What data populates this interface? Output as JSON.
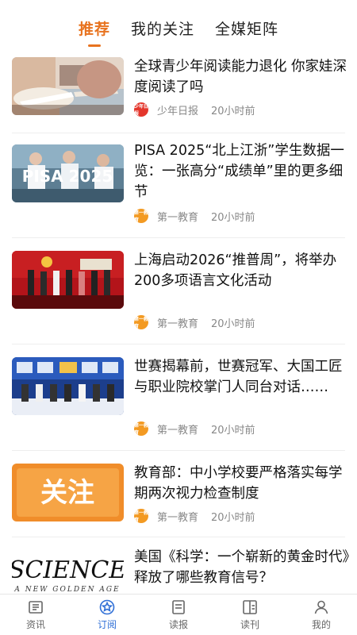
{
  "tabs": [
    {
      "label": "推荐",
      "active": true
    },
    {
      "label": "我的关注",
      "active": false
    },
    {
      "label": "全媒矩阵",
      "active": false
    }
  ],
  "articles": [
    {
      "title": "全球青少年阅读能力退化 你家娃深度阅读了吗",
      "source": "少年日报",
      "source_logo_text": "少年日报",
      "time": "20小时前"
    },
    {
      "title": "PISA 2025“北上江浙”学生数据一览：一张高分“成绩单”里的更多细节",
      "source": "第一教育",
      "source_logo_text": "第一教育",
      "time": "20小时前",
      "thumb_text": "PISA 2025"
    },
    {
      "title": "上海启动2026“推普周”，将举办200多项语言文化活动",
      "source": "第一教育",
      "source_logo_text": "第一教育",
      "time": "20小时前"
    },
    {
      "title": "世赛揭幕前，世赛冠军、大国工匠与职业院校掌门人同台对话……",
      "source": "第一教育",
      "source_logo_text": "第一教育",
      "time": "20小时前"
    },
    {
      "title": "教育部：中小学校要严格落实每学期两次视力检查制度",
      "source": "第一教育",
      "source_logo_text": "第一教育",
      "time": "20小时前",
      "thumb_text": "关注"
    },
    {
      "title": "美国《科学：一个崭新的黄金时代》释放了哪些教育信号？",
      "thumb_text": "SCIENCE",
      "thumb_subtext": "A NEW GOLDEN AGE"
    }
  ],
  "bottom_nav": [
    {
      "label": "资讯",
      "icon": "news-icon",
      "active": false
    },
    {
      "label": "订阅",
      "icon": "subscribe-icon",
      "active": true
    },
    {
      "label": "读报",
      "icon": "newspaper-icon",
      "active": false
    },
    {
      "label": "读刊",
      "icon": "magazine-icon",
      "active": false
    },
    {
      "label": "我的",
      "icon": "user-icon",
      "active": false
    }
  ],
  "colors": {
    "accent": "#e8731f",
    "nav_active": "#2f6fd6"
  }
}
